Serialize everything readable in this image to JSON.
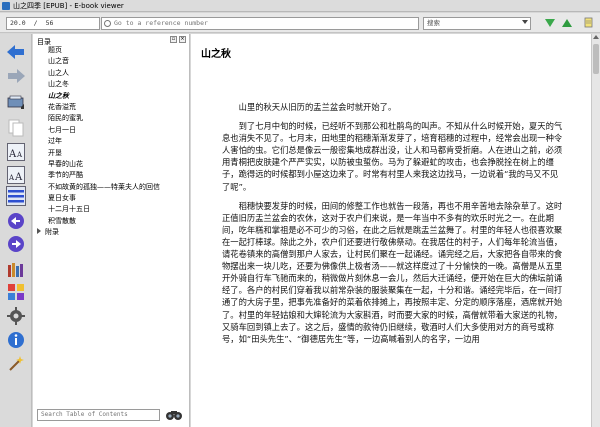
{
  "window": {
    "title": "山之四季 [EPUB] - E-book viewer"
  },
  "toolbar": {
    "position_current": "20.0",
    "position_sep": "/",
    "position_total": "56",
    "reference_placeholder": "Go to a reference number",
    "search_value": "搜索"
  },
  "toc": {
    "header": "目录",
    "items": [
      {
        "label": "题页"
      },
      {
        "label": "山之音"
      },
      {
        "label": "山之人"
      },
      {
        "label": "山之冬"
      },
      {
        "label": "山之秋"
      },
      {
        "label": "花香溢荒"
      },
      {
        "label": "陌民的蜜乳"
      },
      {
        "label": "七月一日"
      },
      {
        "label": "过年"
      },
      {
        "label": "开垦"
      },
      {
        "label": "早春的山花"
      },
      {
        "label": "季节的严酷"
      },
      {
        "label": "不如故黄的孤独——特莱夫人的回信"
      },
      {
        "label": "夏日女事"
      },
      {
        "label": "十二月十五日"
      },
      {
        "label": "积雪散散"
      },
      {
        "label": "附录"
      }
    ],
    "search_placeholder": "Search Table of Contents"
  },
  "content": {
    "chapter_title": "山之秋",
    "paragraphs": [
      "山里的秋天从旧历的盂兰盆会时就开始了。",
      "到了七月中旬的时候，已经听不到那公和杜鹃鸟的叫声。不知从什么时候开始，夏天的气息也消失不见了。七月末，田地里的稻穗渐渐发芽了，培育稻穗的过程中，经常会出现一种令人害怕的虫。它们总是像云一般密集地成群出没，让人和马都肯受折磨。人在进山之前，必须用青桐把皮肤建个严严实实，以防被虫蜇伤。马为了躲避虻的攻击，也会挣脱拴在树上的缰子，跪得远的时候都到小屋这边来了。时常有村里人来我这边找马，一边说着“我的马又不见了呢”。",
      "稻穗快要发芽的时候，田间的修整工作也就告一段落，再也不用辛苦地去除杂草了。这时正值旧历盂兰盆会的农休，这对于农户们来说，是一年当中不多有的欢乐时光之一。在此期间，吃年糕和掌祖是必不可少的习俗，在此之后就是跳盂兰盆舞了。村里的年轻人也很喜欢聚在一起打棒球。除此之外，农户们还要进行敬佛祭动。在我居住的村子，人们每年轮流当值，请花卷镇来的高僧到那户人家去，让村民们聚在一起诵经。诵完经之后，大家把各自带来的食物摆出来一块儿吃，还要为佛像供上极者汤——就这样度过了十分愉快的一晚。高僧是从五里开外骑自行车飞驰而来的，稍微做片刻休息一会儿，然后大迁诵经，便开始在巨大的佛坛前诵经了。各户的村民们穿着我以前常杂装的服装聚集在一起，十分和谐。诵经完毕后，在一间打通了的大房子里，把事先准备好的菜着依排摊上，再按照丰定、分定的顺序落座，酒席就开始了。村里的年轻姑娘和大婶轮流为大家斟酒，时而要大家的时候，高僧就带着大家送的礼物，又骑车回到镇上去了。这之后，盛情的款待仍旧继续，敬酒时人们大多使用对方的商号或称号，如“田头先生”、“御德居先生”等，一边高喊着别人的名字，一边用"
    ]
  },
  "colors": {
    "toolbar_bg": "#e8e8e8",
    "nav_arrow": "#2f6fd0",
    "search_arrow": "#3aa84b",
    "panel_bg": "#ffffff"
  }
}
